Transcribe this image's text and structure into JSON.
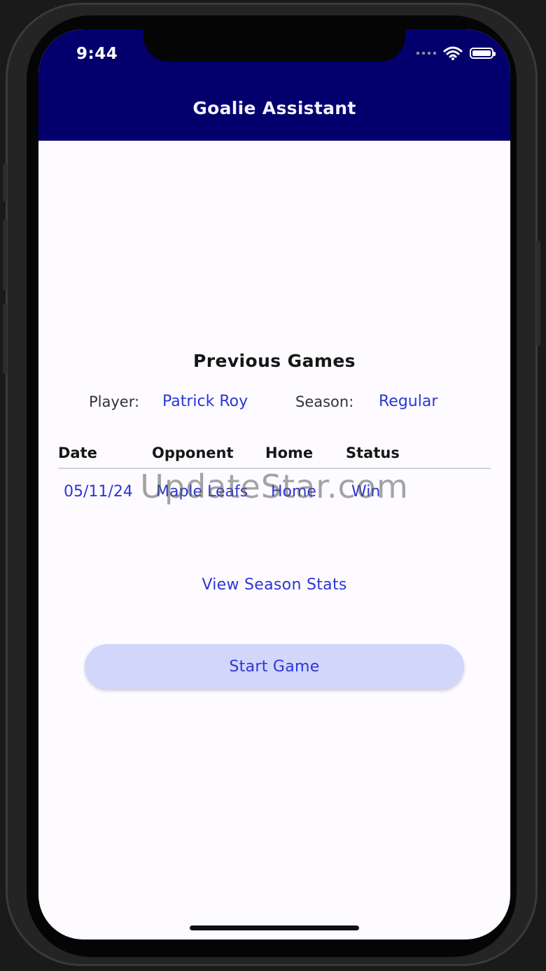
{
  "status_bar": {
    "time": "9:44"
  },
  "header": {
    "title": "Goalie Assistant"
  },
  "main": {
    "title": "Previous Games",
    "player_label": "Player:",
    "player_value": "Patrick Roy",
    "season_label": "Season:",
    "season_value": "Regular",
    "table": {
      "columns": [
        "Date",
        "Opponent",
        "Home",
        "Status"
      ],
      "rows": [
        [
          "05/11/24",
          "Maple Leafs",
          "Home",
          "Win"
        ]
      ]
    },
    "season_stats_link": "View Season Stats",
    "start_button": "Start Game"
  },
  "watermark": "UpdateStar.com",
  "colors": {
    "nav_background": "#03006e",
    "link": "#2a36d6",
    "button_background": "#d3d6fb"
  },
  "icons": [
    "wifi-icon",
    "battery-icon",
    "signal-icon"
  ]
}
